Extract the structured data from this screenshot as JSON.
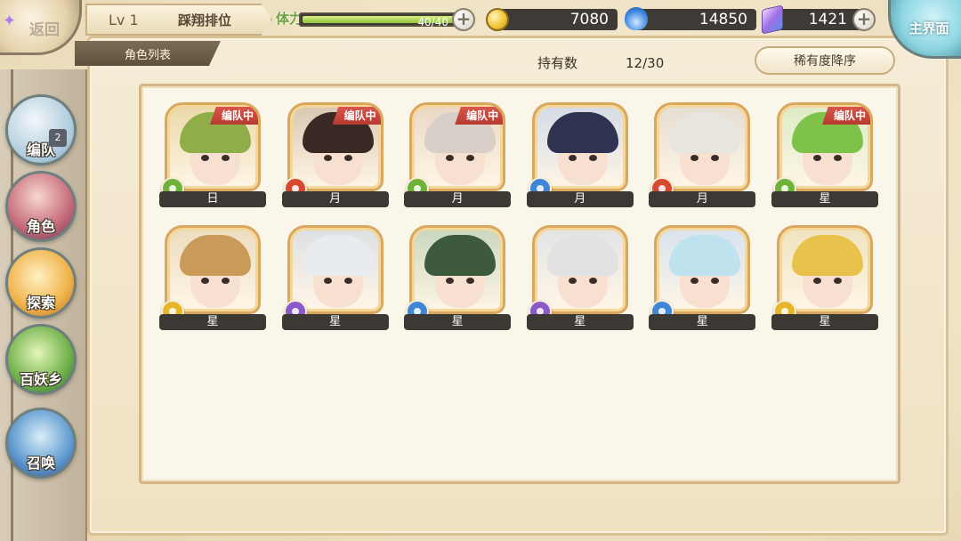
{
  "header": {
    "back_label": "返回",
    "level": "Lv 1",
    "rank_label": "踩翔排位",
    "list_tab": "角色列表",
    "main_menu_label": "主界面"
  },
  "stamina": {
    "label": "体力",
    "value_text": "40/40",
    "fraction": 1.0
  },
  "currencies": {
    "gold": {
      "icon": "gold-coin-icon",
      "value": "7080"
    },
    "soul": {
      "icon": "blue-flame-icon",
      "value": "14850"
    },
    "crystal": {
      "icon": "crystal-icon",
      "value": "1421"
    }
  },
  "roster": {
    "owned_label": "持有数",
    "owned_count": "12/30",
    "sort_label": "稀有度降序",
    "in_team_label": "编队中",
    "characters": [
      {
        "name": "日",
        "element": "wind",
        "in_team": true
      },
      {
        "name": "月",
        "element": "fire",
        "in_team": true
      },
      {
        "name": "月",
        "element": "wind",
        "in_team": true
      },
      {
        "name": "月",
        "element": "water",
        "in_team": false
      },
      {
        "name": "月",
        "element": "fire",
        "in_team": false
      },
      {
        "name": "星",
        "element": "wind",
        "in_team": true
      },
      {
        "name": "星",
        "element": "light",
        "in_team": false
      },
      {
        "name": "星",
        "element": "dark",
        "in_team": false
      },
      {
        "name": "星",
        "element": "water",
        "in_team": false
      },
      {
        "name": "星",
        "element": "dark",
        "in_team": false
      },
      {
        "name": "星",
        "element": "water",
        "in_team": false
      },
      {
        "name": "星",
        "element": "light",
        "in_team": false
      }
    ]
  },
  "nav": {
    "items": [
      {
        "label": "编队",
        "icon": "ghost-team-icon",
        "badge": "2"
      },
      {
        "label": "角色",
        "icon": "character-icon"
      },
      {
        "label": "探索",
        "icon": "compass-icon"
      },
      {
        "label": "百妖乡",
        "icon": "village-icon"
      },
      {
        "label": "召唤",
        "icon": "summon-icon"
      }
    ]
  },
  "colors": {
    "element_wind": "#6fb23a",
    "element_fire": "#d8482e",
    "element_water": "#3f86d6",
    "element_light": "#e7b628",
    "element_dark": "#8a5ac8",
    "in_team": "#c8443a",
    "stamina_fill": "#a8d24f"
  }
}
